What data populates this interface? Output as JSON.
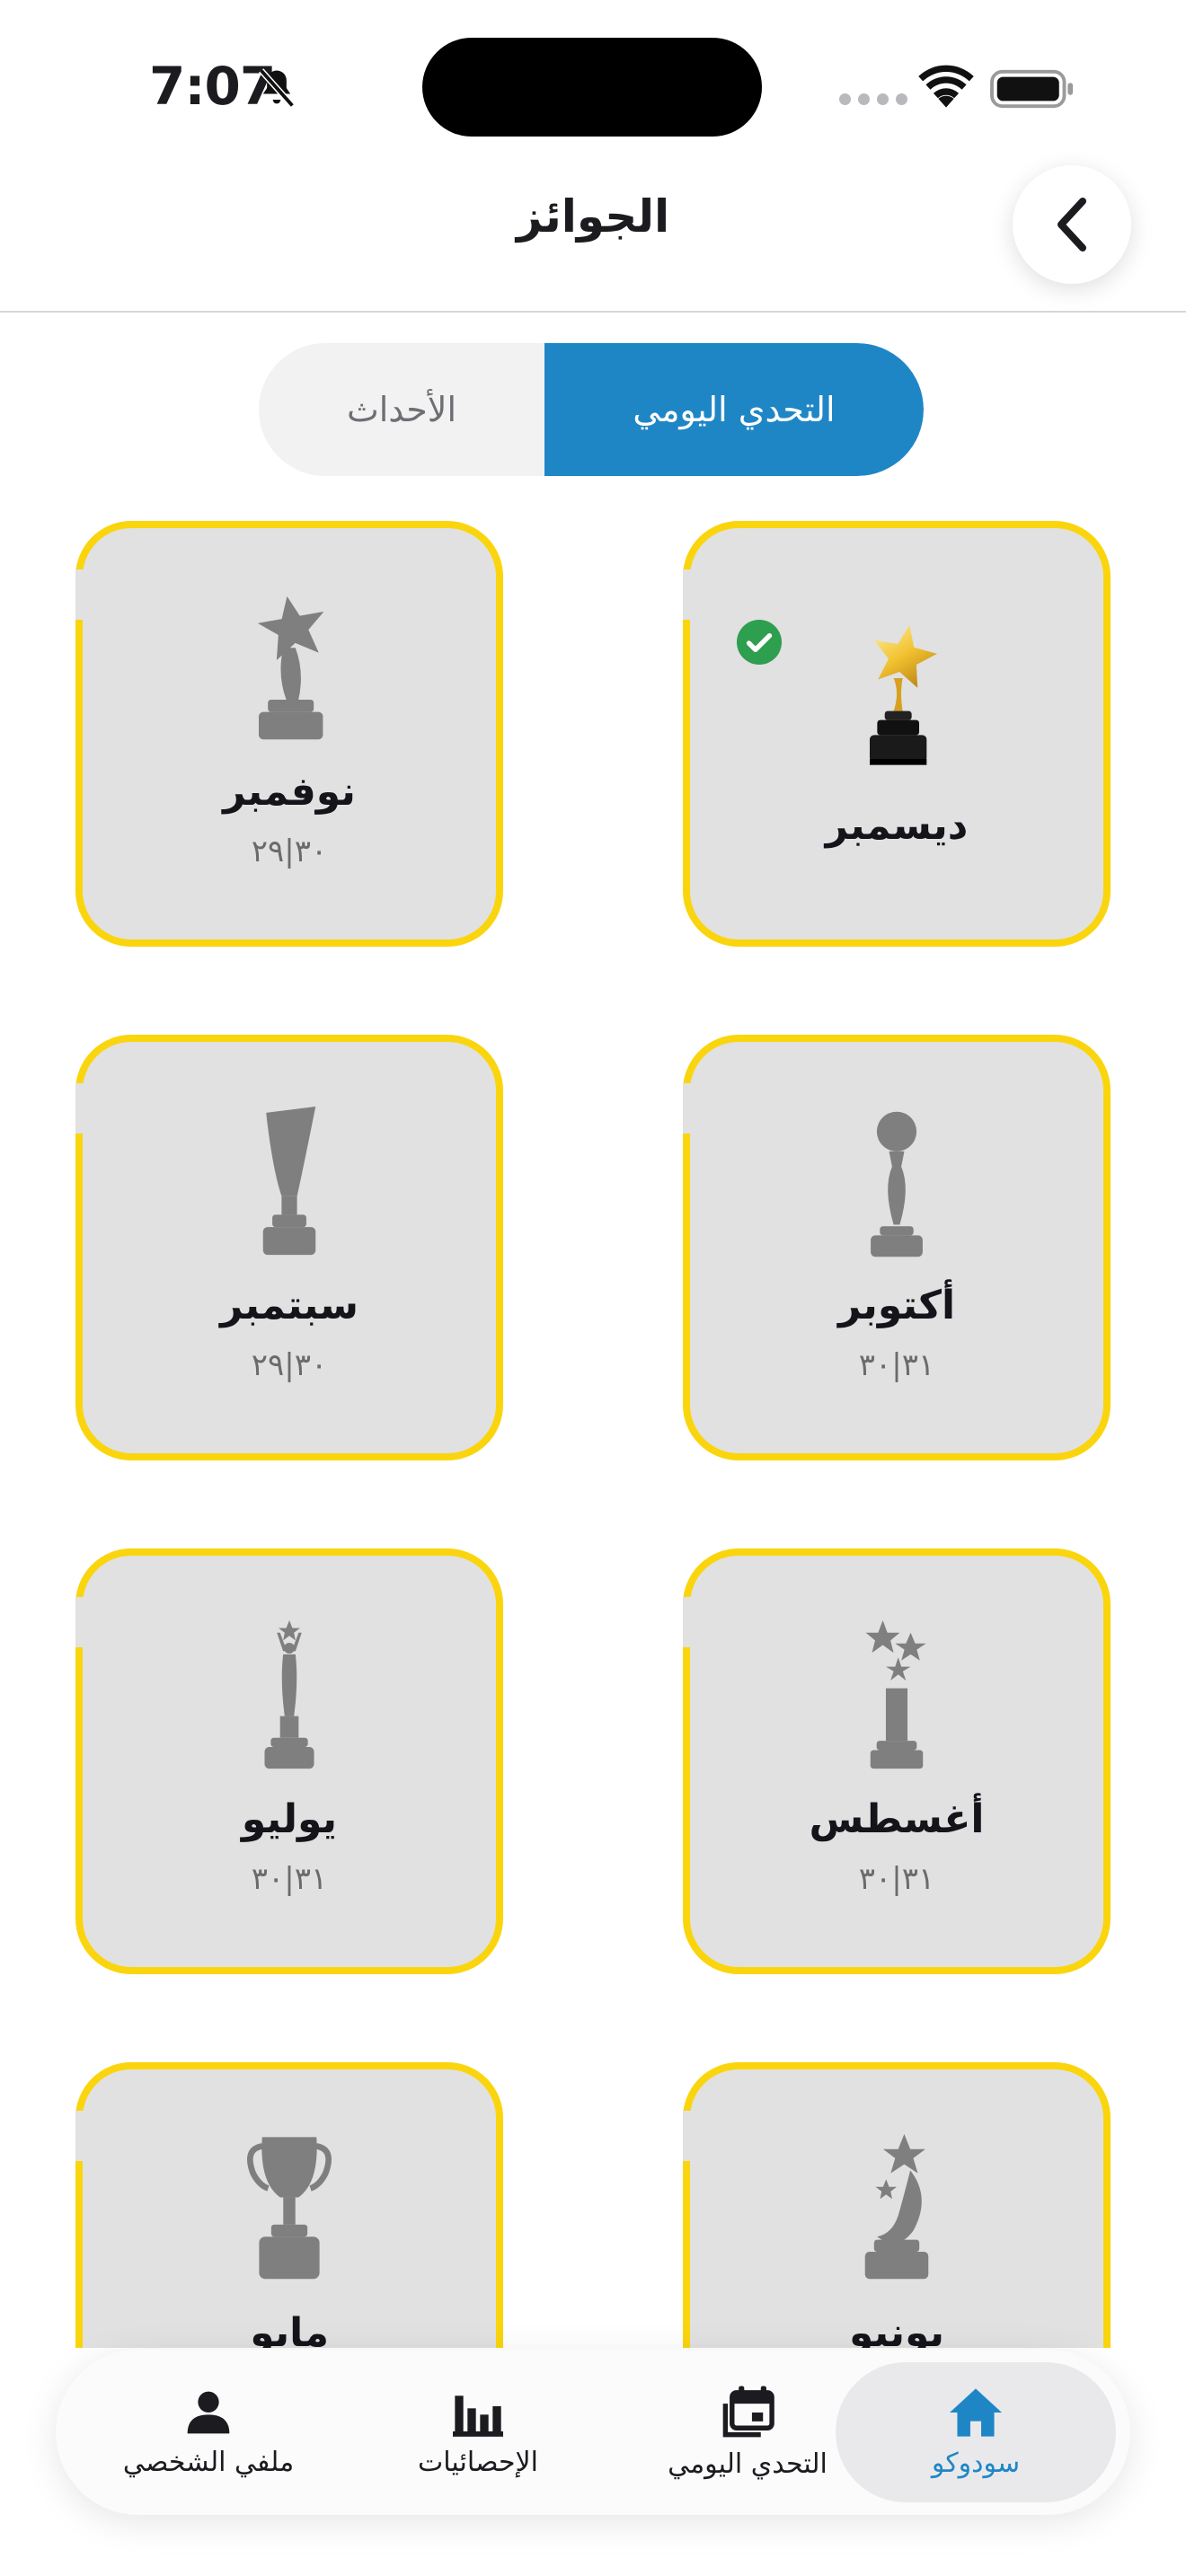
{
  "status": {
    "time": "7:07"
  },
  "header": {
    "title": "الجوائز"
  },
  "tabs": {
    "daily": "التحدي اليومي",
    "events": "الأحداث",
    "selected": "daily"
  },
  "awards": [
    {
      "name": "ديسمبر",
      "count": "",
      "completed": true,
      "icon": "gold-star-trophy-icon"
    },
    {
      "name": "نوفمبر",
      "count": "٣٠|٢٩",
      "completed": false,
      "icon": "star-trophy-icon"
    },
    {
      "name": "أكتوبر",
      "count": "٣١|٣٠",
      "completed": false,
      "icon": "ball-trophy-icon"
    },
    {
      "name": "سبتمبر",
      "count": "٣٠|٢٩",
      "completed": false,
      "icon": "flame-trophy-icon"
    },
    {
      "name": "أغسطس",
      "count": "٣١|٣٠",
      "completed": false,
      "icon": "stars-trophy-icon"
    },
    {
      "name": "يوليو",
      "count": "٣١|٣٠",
      "completed": false,
      "icon": "figure-trophy-icon"
    },
    {
      "name": "يونيو",
      "count": "",
      "completed": false,
      "icon": "swirl-trophy-icon"
    },
    {
      "name": "مايو",
      "count": "",
      "completed": false,
      "icon": "cup-trophy-icon"
    }
  ],
  "nav": {
    "home": "سودوكو",
    "daily": "التحدي اليومي",
    "stats": "الإحصائيات",
    "profile": "ملفي الشخصي",
    "active": "home"
  },
  "colors": {
    "accent": "#1f86c6",
    "card_border": "#fad50d",
    "card_bg": "#e1e1e1",
    "trophy_gray": "#7f7f7f"
  }
}
